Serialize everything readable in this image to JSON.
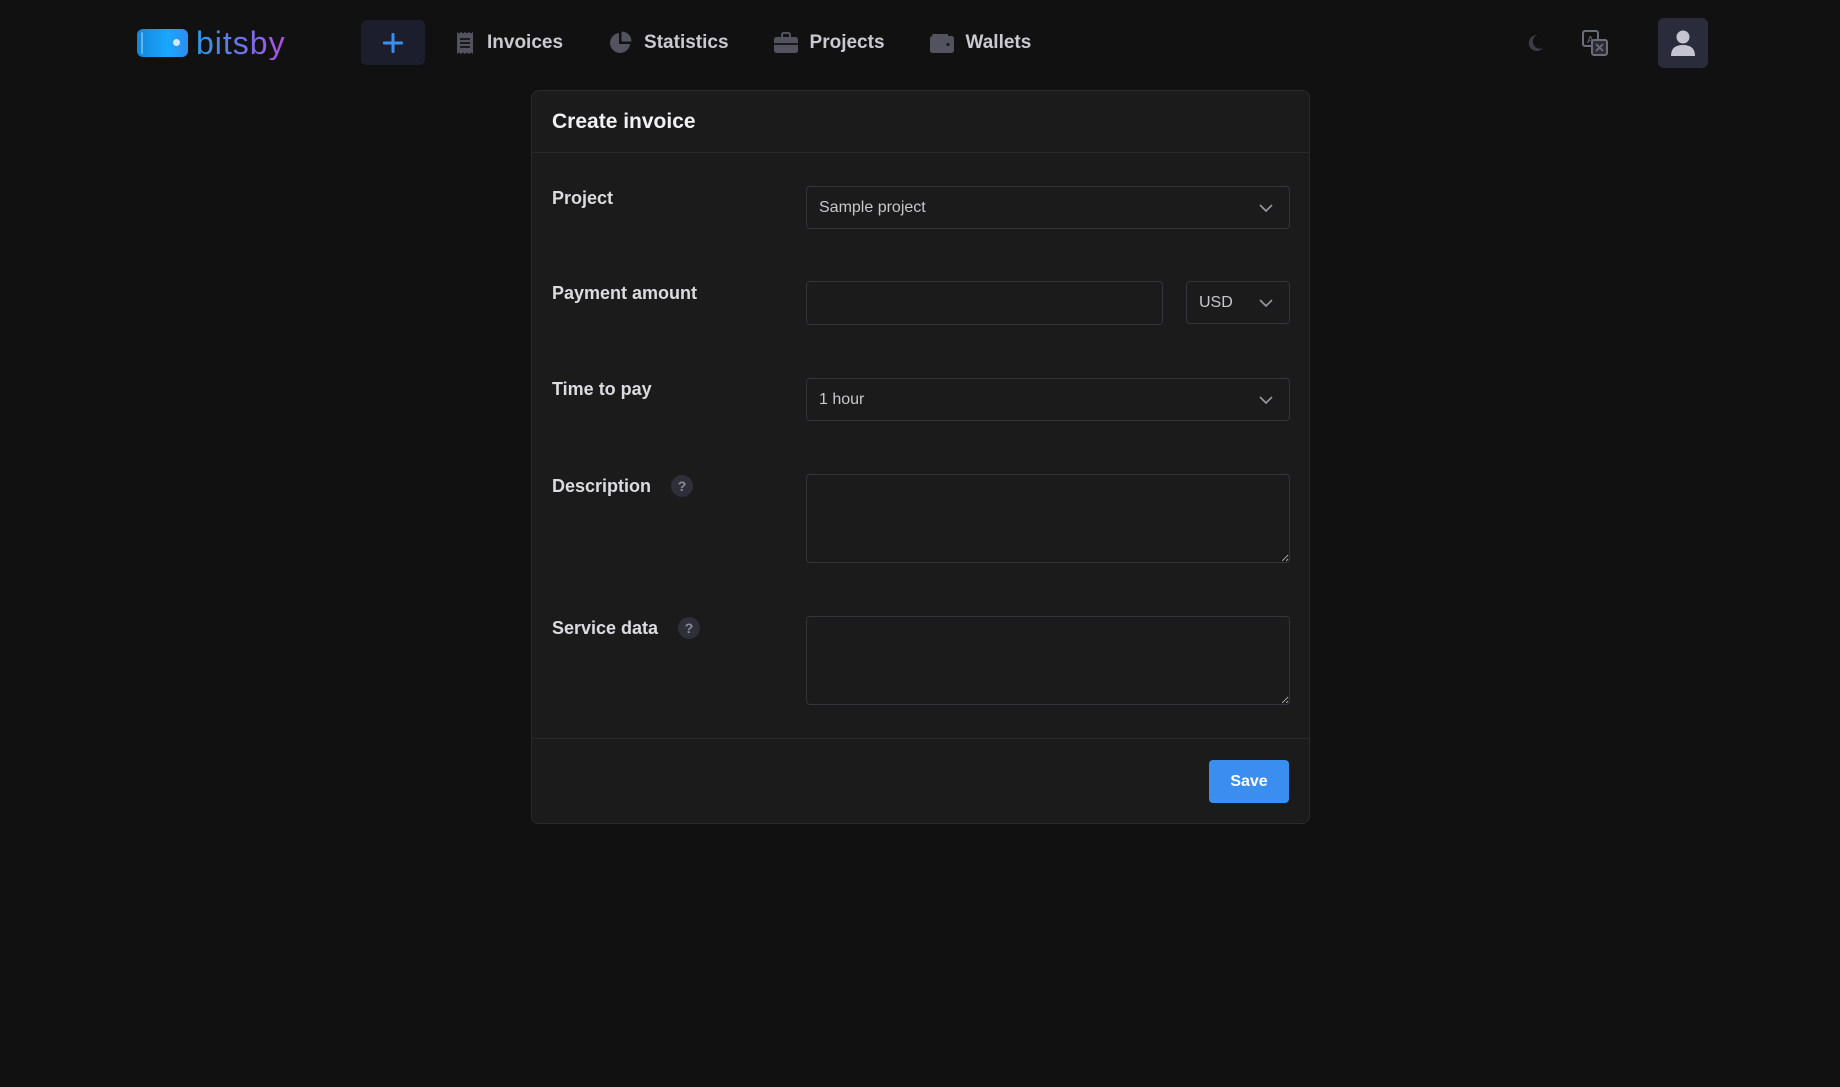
{
  "brand": {
    "name": "bitsby"
  },
  "header": {
    "add_button_icon": "plus-icon",
    "nav": [
      {
        "label": "Invoices",
        "icon": "receipt-icon"
      },
      {
        "label": "Statistics",
        "icon": "pie-chart-icon"
      },
      {
        "label": "Projects",
        "icon": "briefcase-icon"
      },
      {
        "label": "Wallets",
        "icon": "wallet-icon"
      }
    ],
    "theme_toggle_icon": "moon-icon",
    "language_icon": "translate-icon",
    "profile_icon": "user-icon"
  },
  "form": {
    "title": "Create invoice",
    "project": {
      "label": "Project",
      "value": "Sample project"
    },
    "payment_amount": {
      "label": "Payment amount",
      "value": "",
      "currency": "USD"
    },
    "time_to_pay": {
      "label": "Time to pay",
      "value": "1 hour"
    },
    "description": {
      "label": "Description",
      "help": "?",
      "value": ""
    },
    "service_data": {
      "label": "Service data",
      "help": "?",
      "value": ""
    },
    "save_label": "Save"
  },
  "colors": {
    "background": "#111112",
    "card": "#1b1b1c",
    "accent": "#3a8eef",
    "text": "#e4e4e7"
  }
}
